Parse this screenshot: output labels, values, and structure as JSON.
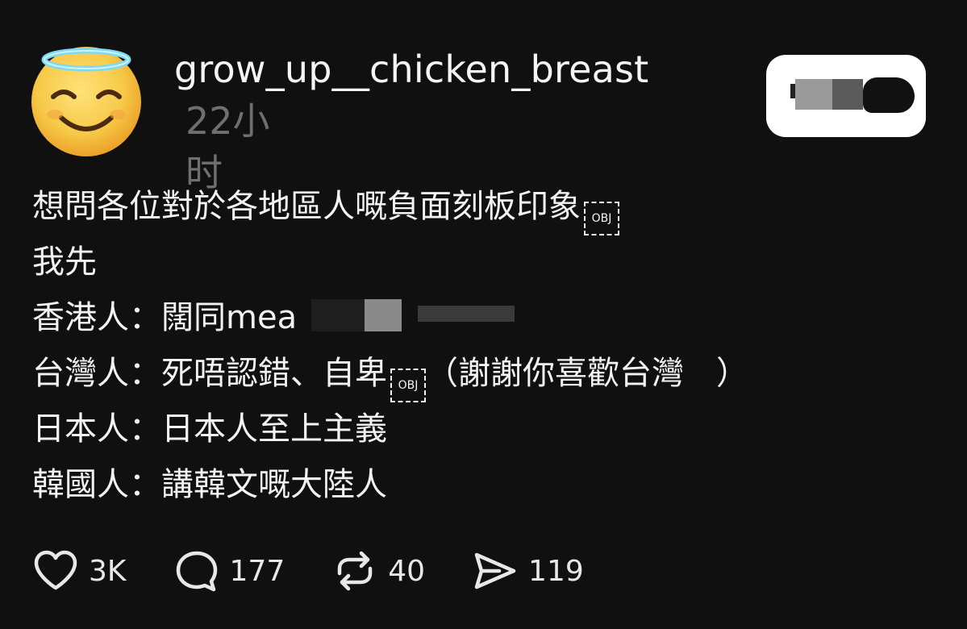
{
  "post": {
    "username": "grow_up__chicken_breast",
    "timestamp": "22小时",
    "avatar_icon": "smiling-face-with-halo-emoji",
    "lines": {
      "line1": "想問各位對於各地區人嘅負面刻板印象",
      "line1_obj": "OBJ",
      "line2": "我先",
      "line3": "香港人：闊同mea",
      "line4a": "台灣人：死唔認錯、自卑",
      "line4_obj": "OBJ",
      "line4b": "（謝謝你喜歡台灣　）",
      "line5": "日本人：日本人至上主義",
      "line6": "韓國人：講韓文嘅大陸人"
    }
  },
  "actions": {
    "likes": "3K",
    "comments": "177",
    "reposts": "40",
    "shares": "119"
  },
  "colors": {
    "background": "#101010",
    "text": "#f3f3f3",
    "timestamp": "#6f6f6f"
  }
}
